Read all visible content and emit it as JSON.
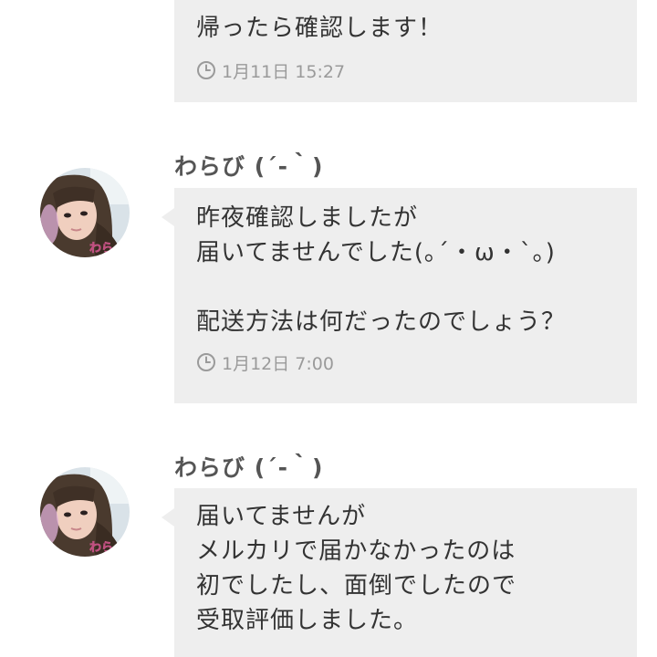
{
  "messages": [
    {
      "text": "帰ったら確認します！",
      "time": "1月11日 15:27"
    },
    {
      "sender": "わらび (´-｀)",
      "avatar_text": "わら",
      "text": "昨夜確認しましたが\n届いてませんでした(｡´・ω・`｡)\n\n配送方法は何だったのでしょう？",
      "time": "1月12日 7:00"
    },
    {
      "sender": "わらび (´-｀)",
      "avatar_text": "わら",
      "text": "届いてませんが\nメルカリで届かなかったのは\n初でしたし、面倒でしたので\n受取評価しました。"
    }
  ],
  "colors": {
    "bubble": "#eeeeee",
    "text": "#333333",
    "time": "#9a9a9a",
    "sender": "#555555"
  }
}
